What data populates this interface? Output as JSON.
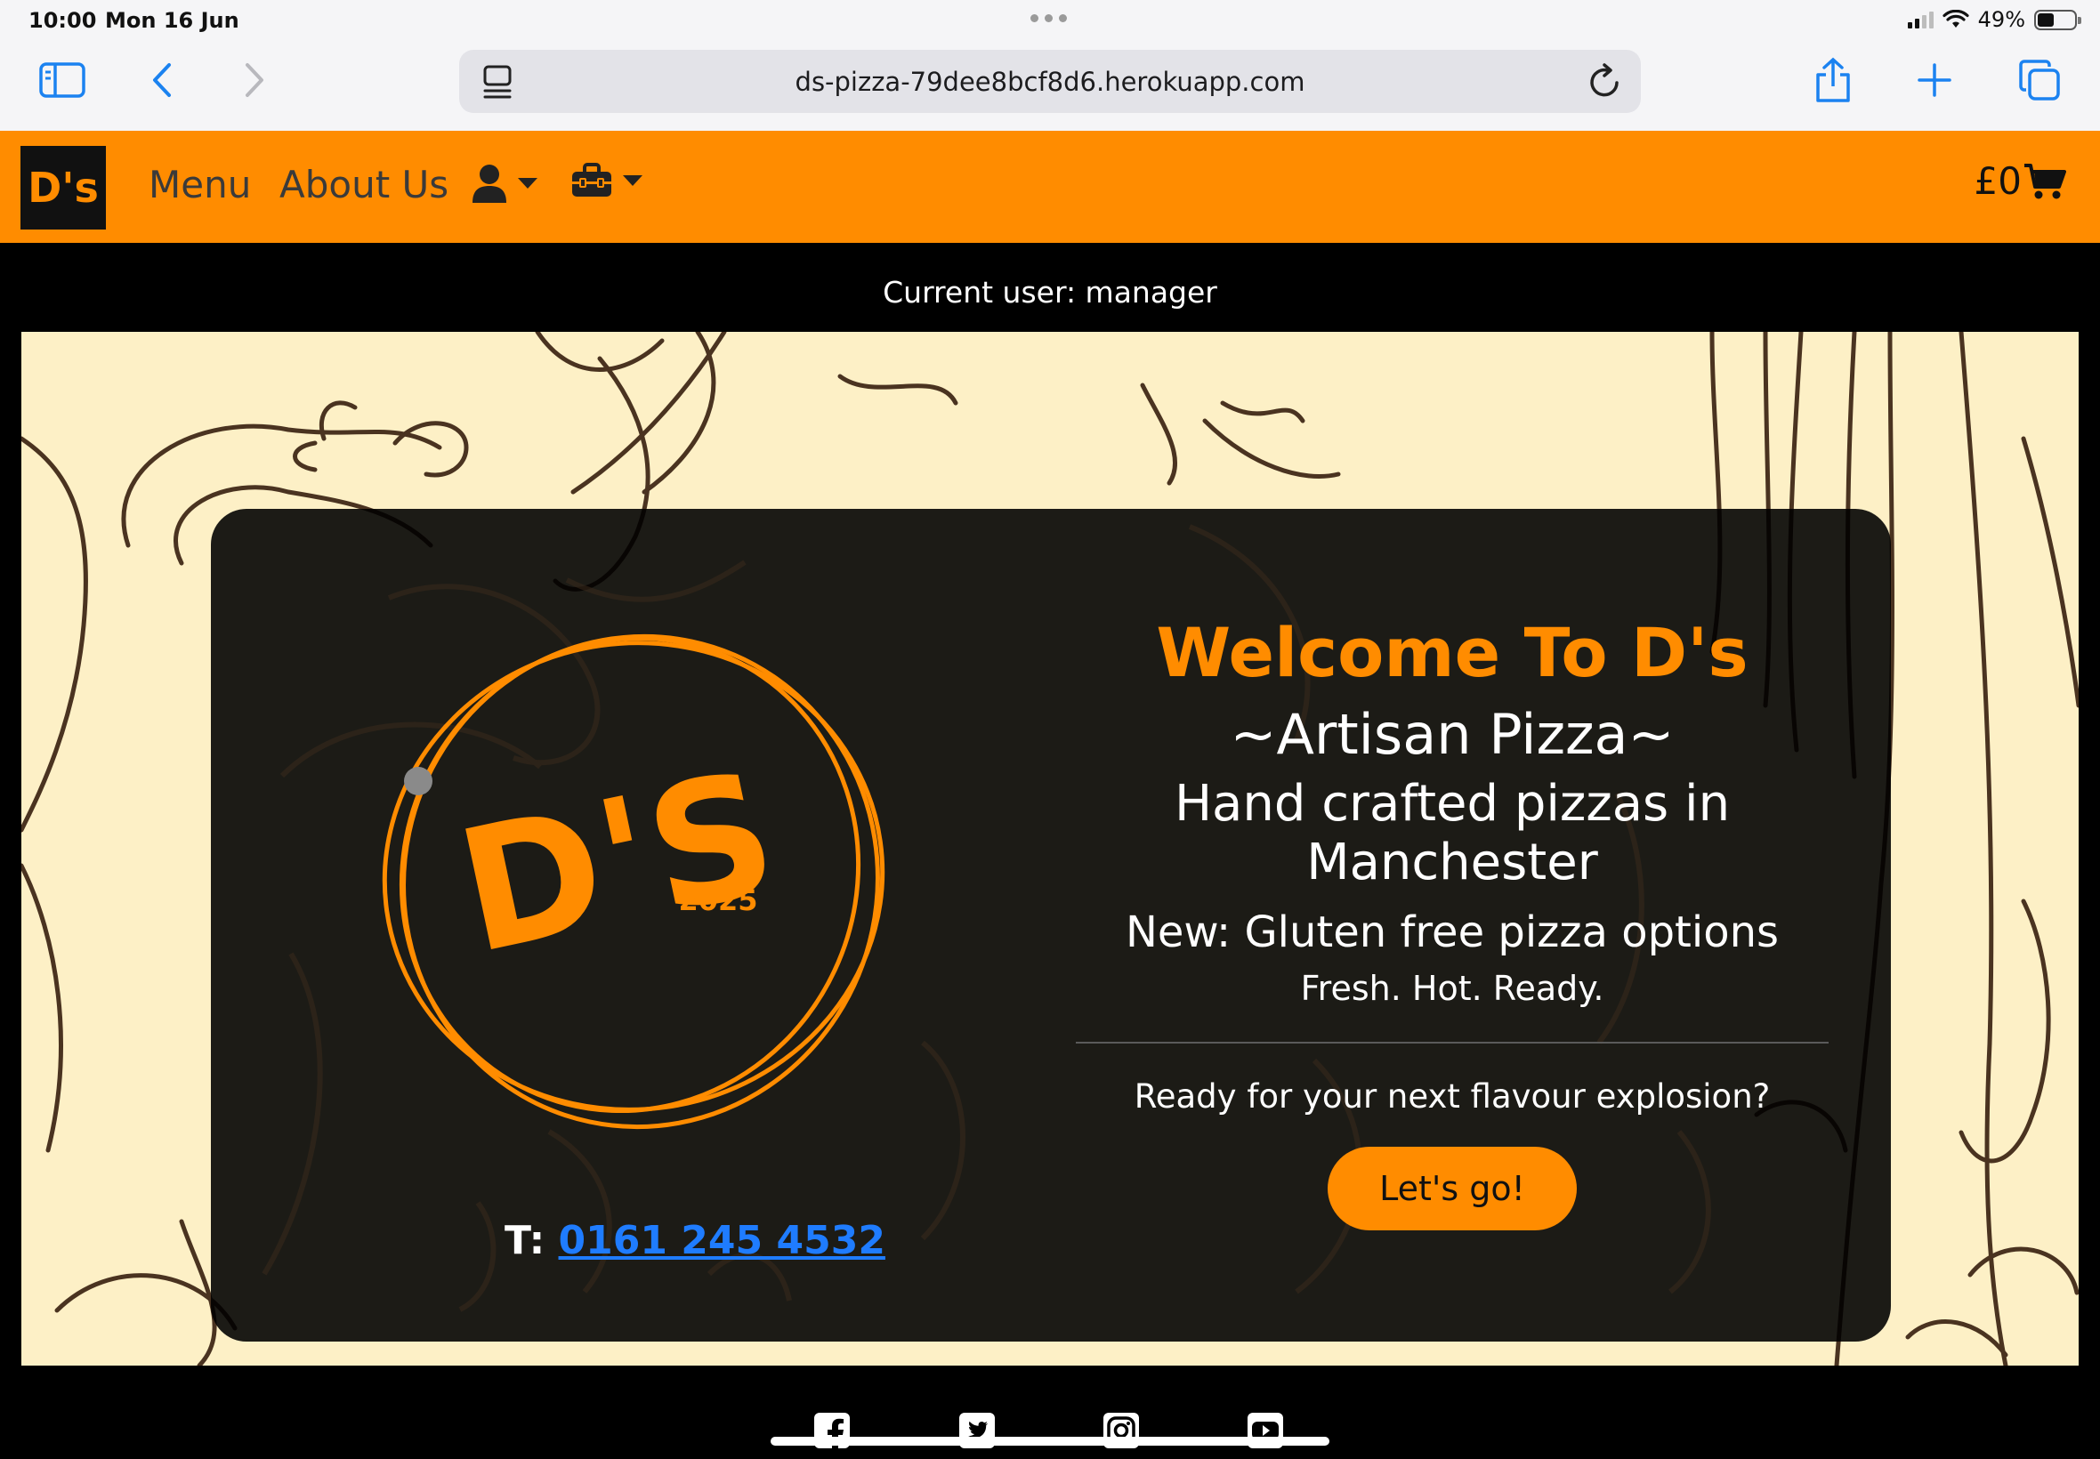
{
  "status_bar": {
    "time": "10:00",
    "date": "Mon 16 Jun",
    "battery": "49%"
  },
  "browser": {
    "url": "ds-pizza-79dee8bcf8d6.herokuapp.com"
  },
  "navbar": {
    "brand": "D's",
    "links": [
      "Menu",
      "About Us"
    ],
    "account_icon": "user-icon",
    "manage_icon": "toolbox-icon",
    "cart_total": "£0",
    "colors": {
      "bar": "#ff8c00",
      "text": "#3a3a3a"
    }
  },
  "user_banner": {
    "text": "Current user: manager"
  },
  "hero": {
    "logo_text": "D'S",
    "logo_year": "2025",
    "phone_prefix": "T:",
    "phone_number": "0161 245 4532",
    "welcome": "Welcome To D's",
    "tagline": "~Artisan Pizza~",
    "subtitle": "Hand crafted pizzas in Manchester",
    "gluten": "New: Gluten free pizza options",
    "fresh": "Fresh. Hot. Ready.",
    "prompt": "Ready for your next flavour explosion?",
    "cta": "Let's go!",
    "colors": {
      "accent": "#ff8c00",
      "card": "#111111",
      "background": "#fdf0c6",
      "link": "#1f7cff"
    }
  },
  "footer": {
    "social_icons": [
      "facebook-icon",
      "twitter-icon",
      "instagram-icon",
      "youtube-icon"
    ]
  }
}
